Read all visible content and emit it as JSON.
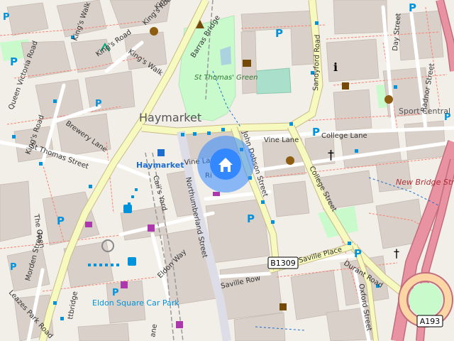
{
  "map": {
    "area_labels": {
      "haymarket": "Haymarket",
      "sport_central": "Sport Central",
      "st_thomas_green": "St Thomas' Green",
      "eldon_square_car_park": "Eldon Square Car Park"
    },
    "station_label": "Haymarket",
    "road_labels": {
      "kings_walk": "King's Walk",
      "kings_road": "King's Road",
      "kings_walk_2": "King's Walk",
      "kings_road_2": "King's Road",
      "kings_walk_3": "King's Walk",
      "barras_bridge": "Barras Bridge",
      "queen_victoria_road": "Queen Victoria Road",
      "brewery_lane": "Brewery Lane",
      "kings_road_3": "King's Road",
      "st_thomas_street": "St Thomas Street",
      "sandyford_road": "Sandyford Road",
      "day_street": "Day Street",
      "radnor_street": "Radnor Street",
      "college_lane": "College Lane",
      "vine_lane": "Vine Lane",
      "vine_lane_2": "Vine Lane",
      "john_dobson_street": "John Dobson Street",
      "college_street": "College Street",
      "new_bridge_street": "New Bridge Street",
      "northumberland_street": "Northumberland Street",
      "cails_yard": "Cail's Yard",
      "the_open": "The Open",
      "morden_street": "Morden Street",
      "eldon_way": "Eldon Way",
      "saville_row": "Saville Row",
      "saville_place": "Saville Place",
      "durant_road": "Durant Road",
      "oxford_street": "Oxford Street",
      "leazes_park_road": "Leazes Park Road",
      "bridge_partial": "ttbridge",
      "lane_partial": "ane",
      "ri_partial": "Ri"
    },
    "shields": {
      "b1309": "B1309",
      "a193": "A193"
    },
    "parking_symbol": "P",
    "home_marker_icon": "home-icon",
    "colors": {
      "background": "#f2efe9",
      "building": "#d9d0c9",
      "primary_road": "#fcd6a4",
      "secondary_road": "#f7fabf",
      "trunk_road": "#e892a2",
      "park": "#c8facc",
      "pitch": "#aae0cb",
      "footway": "#fa8072",
      "bus_stop": "#0092da",
      "marker": "#3388ff",
      "rail": "#aaaaaa"
    }
  }
}
